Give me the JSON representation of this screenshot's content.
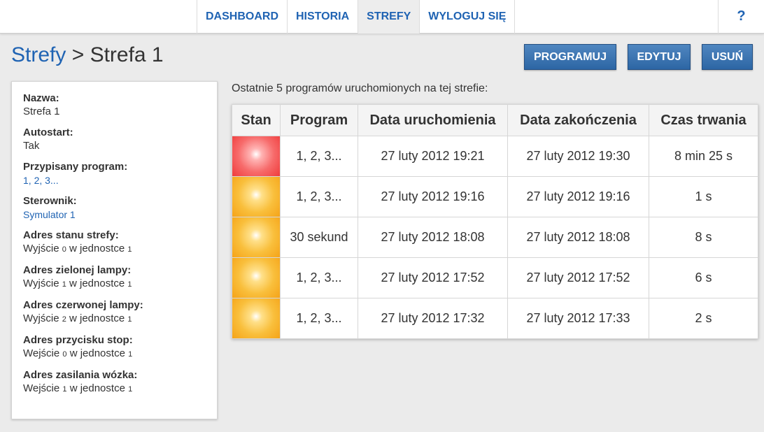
{
  "nav": {
    "items": [
      {
        "label": "DASHBOARD",
        "name": "nav-dashboard"
      },
      {
        "label": "HISTORIA",
        "name": "nav-historia"
      },
      {
        "label": "STREFY",
        "name": "nav-strefy",
        "active": true
      },
      {
        "label": "WYLOGUJ SIĘ",
        "name": "nav-wyloguj"
      }
    ],
    "help": "?"
  },
  "header": {
    "crumb_link": "Strefy",
    "crumb_sep": " > ",
    "crumb_current": "Strefa 1",
    "buttons": {
      "program": "PROGRAMUJ",
      "edit": "EDYTUJ",
      "delete": "USUŃ"
    }
  },
  "details": {
    "nazwa_lbl": "Nazwa:",
    "nazwa": "Strefa 1",
    "autostart_lbl": "Autostart:",
    "autostart": "Tak",
    "program_lbl": "Przypisany program:",
    "program": "1, 2, 3...",
    "sterownik_lbl": "Sterownik:",
    "sterownik": "Symulator 1",
    "stan_lbl": "Adres stanu strefy:",
    "stan_a": "Wyjście ",
    "stan_n1": "0",
    "stan_b": " w jednostce ",
    "stan_n2": "1",
    "ziel_lbl": "Adres zielonej lampy:",
    "ziel_a": "Wyjście ",
    "ziel_n1": "1",
    "ziel_b": " w jednostce ",
    "ziel_n2": "1",
    "czer_lbl": "Adres czerwonej lampy:",
    "czer_a": "Wyjście ",
    "czer_n1": "2",
    "czer_b": " w jednostce ",
    "czer_n2": "1",
    "stop_lbl": "Adres przycisku stop:",
    "stop_a": "Wejście ",
    "stop_n1": "0",
    "stop_b": " w jednostce ",
    "stop_n2": "1",
    "zas_lbl": "Adres zasilania wózka:",
    "zas_a": "Wejście ",
    "zas_n1": "1",
    "zas_b": " w jednostce ",
    "zas_n2": "1"
  },
  "history": {
    "caption": "Ostatnie 5 programów uruchomionych na tej strefie:",
    "columns": [
      "Stan",
      "Program",
      "Data uruchomienia",
      "Data zakończenia",
      "Czas trwania"
    ],
    "rows": [
      {
        "status": "red",
        "program": "1, 2, 3...",
        "start": "27 luty 2012 19:21",
        "end": "27 luty 2012 19:30",
        "duration": "8 min 25 s"
      },
      {
        "status": "orange",
        "program": "1, 2, 3...",
        "start": "27 luty 2012 19:16",
        "end": "27 luty 2012 19:16",
        "duration": "1 s"
      },
      {
        "status": "orange",
        "program": "30 sekund",
        "start": "27 luty 2012 18:08",
        "end": "27 luty 2012 18:08",
        "duration": "8 s"
      },
      {
        "status": "orange",
        "program": "1, 2, 3...",
        "start": "27 luty 2012 17:52",
        "end": "27 luty 2012 17:52",
        "duration": "6 s"
      },
      {
        "status": "orange",
        "program": "1, 2, 3...",
        "start": "27 luty 2012 17:32",
        "end": "27 luty 2012 17:33",
        "duration": "2 s"
      }
    ]
  },
  "colors": {
    "link": "#1f63b3",
    "button": "#3a74b3",
    "status_red": "#ef3b3b",
    "status_orange": "#f5a318"
  }
}
